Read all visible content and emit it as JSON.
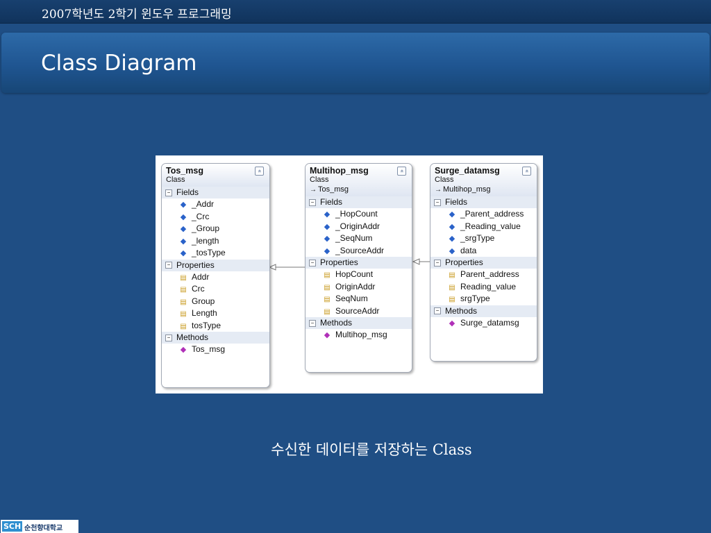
{
  "header": {
    "course": "2007학년도 2학기 윈도우 프로그래밍"
  },
  "slide": {
    "title": "Class Diagram",
    "caption": "수신한 데이터를 저장하는 Class"
  },
  "footer": {
    "logo_mark": "SCH",
    "logo_text": "순천향대학교"
  },
  "diagram": {
    "section_labels": {
      "fields": "Fields",
      "properties": "Properties",
      "methods": "Methods"
    },
    "classes": [
      {
        "name": "Tos_msg",
        "kind": "Class",
        "base": "",
        "fields": [
          "_Addr",
          "_Crc",
          "_Group",
          "_length",
          "_tosType"
        ],
        "properties": [
          "Addr",
          "Crc",
          "Group",
          "Length",
          "tosType"
        ],
        "methods": [
          "Tos_msg"
        ]
      },
      {
        "name": "Multihop_msg",
        "kind": "Class",
        "base": "Tos_msg",
        "fields": [
          "_HopCount",
          "_OriginAddr",
          "_SeqNum",
          "_SourceAddr"
        ],
        "properties": [
          "HopCount",
          "OriginAddr",
          "SeqNum",
          "SourceAddr"
        ],
        "methods": [
          "Multihop_msg"
        ]
      },
      {
        "name": "Surge_datamsg",
        "kind": "Class",
        "base": "Multihop_msg",
        "fields": [
          "_Parent_address",
          "_Reading_value",
          "_srgType",
          "data"
        ],
        "properties": [
          "Parent_address",
          "Reading_value",
          "srgType"
        ],
        "methods": [
          "Surge_datamsg"
        ]
      }
    ]
  },
  "colors": {
    "background": "#1f4e84",
    "topbar": "#153a66",
    "diagram_bg": "#ffffff"
  },
  "icons": {
    "field": "field-icon",
    "property": "property-icon",
    "method": "method-icon",
    "collapse": "collapse-chevrons-icon",
    "inherit": "inherit-arrow-icon"
  }
}
